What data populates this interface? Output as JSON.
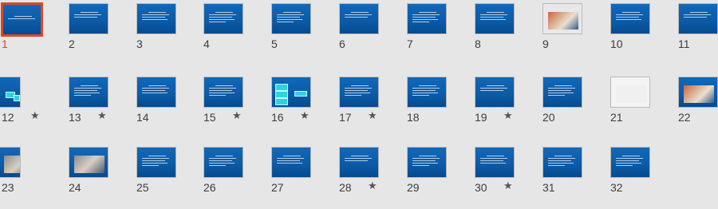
{
  "slides": [
    {
      "number": "1",
      "selected": true
    },
    {
      "number": "2"
    },
    {
      "number": "3"
    },
    {
      "number": "4"
    },
    {
      "number": "5"
    },
    {
      "number": "6"
    },
    {
      "number": "7"
    },
    {
      "number": "8"
    },
    {
      "number": "9"
    },
    {
      "number": "10"
    },
    {
      "number": "11"
    },
    {
      "number": "12",
      "star": "★"
    },
    {
      "number": "13",
      "star": "★"
    },
    {
      "number": "14"
    },
    {
      "number": "15",
      "star": "★"
    },
    {
      "number": "16",
      "star": "★"
    },
    {
      "number": "17",
      "star": "★"
    },
    {
      "number": "18"
    },
    {
      "number": "19",
      "star": "★"
    },
    {
      "number": "20"
    },
    {
      "number": "21"
    },
    {
      "number": "22"
    },
    {
      "number": "23"
    },
    {
      "number": "24"
    },
    {
      "number": "25"
    },
    {
      "number": "26"
    },
    {
      "number": "27"
    },
    {
      "number": "28",
      "star": "★"
    },
    {
      "number": "29"
    },
    {
      "number": "30",
      "star": "★"
    },
    {
      "number": "31"
    },
    {
      "number": "32"
    }
  ],
  "colors": {
    "selected": "#d64a2a",
    "slide_bg": "#0b5aa6"
  }
}
